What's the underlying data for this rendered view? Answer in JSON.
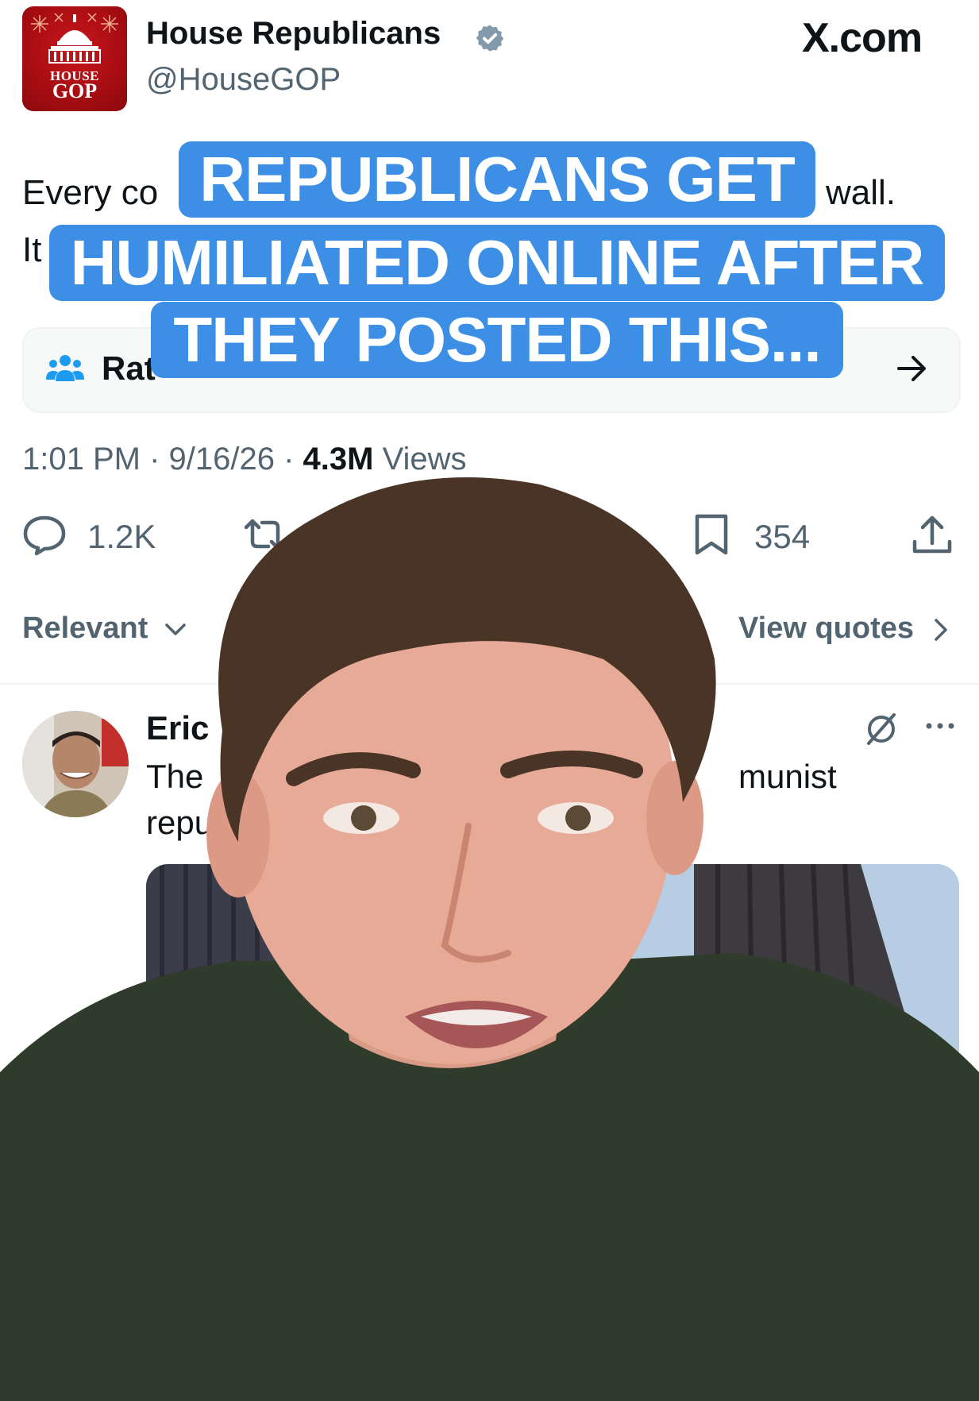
{
  "post": {
    "author_name": "House Republicans",
    "author_handle": "@HouseGOP",
    "avatar_text_top": "HOUSE",
    "avatar_text_bottom": "GOP",
    "site": "X.com",
    "text_line1_start": "Every co",
    "text_line1_end": "wall.",
    "text_line2_start": "It",
    "community_label": "Rat",
    "time": "1:01 PM · 9/16/26 · ",
    "views_count": "4.3M",
    "views_label": " Views"
  },
  "actions": {
    "replies": "1.2K",
    "bookmarks": "354"
  },
  "sort": {
    "label": "Relevant",
    "view_quotes": "View quotes"
  },
  "reply": {
    "name": "Eric",
    "line1_start": "The",
    "line1_end": "munist",
    "line2_start": "repu"
  },
  "caption": {
    "line1": "REPUBLICANS GET",
    "line2": "HUMILIATED ONLINE AFTER",
    "line3": "THEY POSTED THIS..."
  },
  "colors": {
    "caption_bg": "#3d8fe6",
    "verified": "#829aab",
    "community_icon": "#1d9bf0",
    "text_secondary": "#536471"
  }
}
